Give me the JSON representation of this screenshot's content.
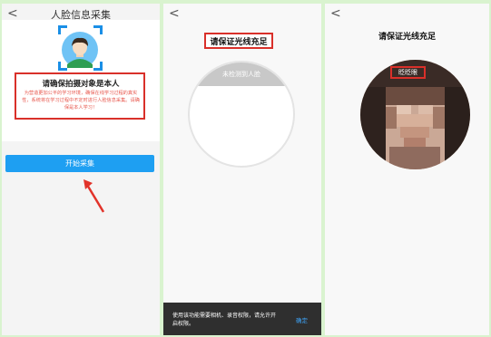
{
  "panel1": {
    "back": "<",
    "title": "人脸信息采集",
    "notice_title": "请确保拍摄对象是本人",
    "notice_text": "为营造更加公平的学习环境，确保在线学习过程的真实性，系统将在学习过程中不定时进行人脸信息采集。请确保是本人学习！",
    "start_button": "开始采集"
  },
  "panel2": {
    "back": "<",
    "title": "请保证光线充足",
    "camera_status": "未检测到人脸",
    "permission_text": "使用该功能需要相机、录音权限，请允许开启权限。",
    "confirm": "确定"
  },
  "panel3": {
    "back": "<",
    "title": "请保证光线充足",
    "blink_prompt": "眨眨眼"
  },
  "colors": {
    "accent": "#1e9ff2",
    "highlight_border": "#d9302a",
    "background": "#d9f3cf"
  }
}
